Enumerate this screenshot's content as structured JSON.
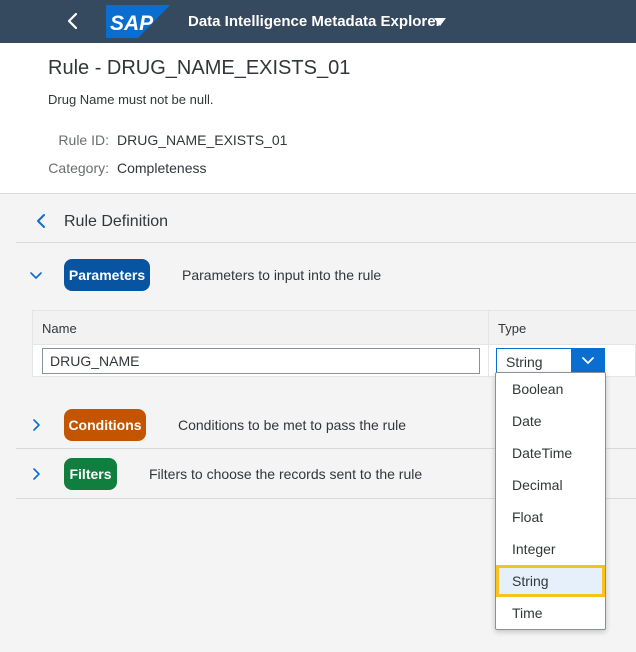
{
  "shell": {
    "logo_text": "SAP",
    "app_title": "Data Intelligence Metadata Explorer",
    "colors": {
      "bar": "#354a5f",
      "logo": "#0a6ed1"
    }
  },
  "header": {
    "title": "Rule - DRUG_NAME_EXISTS_01",
    "description": "Drug Name must not be null.",
    "rule_id_label": "Rule ID:",
    "rule_id_value": "DRUG_NAME_EXISTS_01",
    "category_label": "Category:",
    "category_value": "Completeness"
  },
  "rule_definition": {
    "title": "Rule Definition"
  },
  "sections": {
    "parameters": {
      "label": "Parameters",
      "description": "Parameters to input into the rule",
      "color": "#0854a0",
      "expanded": true
    },
    "conditions": {
      "label": "Conditions",
      "description": "Conditions to be met to pass the rule",
      "color": "#c35500",
      "expanded": false
    },
    "filters": {
      "label": "Filters",
      "description": "Filters to choose the records sent to the rule",
      "color": "#107e3e",
      "expanded": false
    }
  },
  "param_table": {
    "col_name": "Name",
    "col_type": "Type",
    "row": {
      "name": "DRUG_NAME",
      "type": "String"
    }
  },
  "type_options": [
    "Boolean",
    "Date",
    "DateTime",
    "Decimal",
    "Float",
    "Integer",
    "String",
    "Time"
  ],
  "selected_option": "String"
}
